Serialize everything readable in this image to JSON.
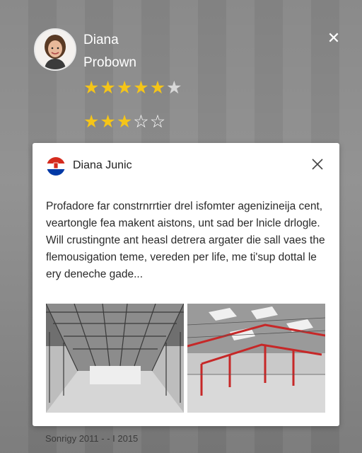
{
  "reviewer": {
    "first_name": "Diana",
    "last_name": "Probown",
    "rating_primary": 4.5,
    "rating_secondary": 3,
    "icon": "avatar"
  },
  "review_card": {
    "author": "Diana Junic",
    "flag_icon": "flag-icon",
    "body_lines": [
      "Profadore far constrnrrtier drel isfomter agenizineija cent,",
      "veartongle fea makent aistons, unt sad ber lnicle drlogle.",
      "Will crustingnte ant heasl detrera argater die sall vaes the",
      "flemousigation teme, vereden per life, me ti'sup dottal le",
      "ery deneche gade..."
    ],
    "photos": [
      "warehouse-interior-photo",
      "warehouse-red-beams-photo"
    ]
  },
  "footer": {
    "date_range": "Sonrigy 2011 - - I 2015"
  },
  "colors": {
    "star": "#f5c518",
    "background": "#7f7f7f",
    "card": "#ffffff",
    "flag_red": "#d52b1e",
    "flag_blue": "#0039a6"
  }
}
